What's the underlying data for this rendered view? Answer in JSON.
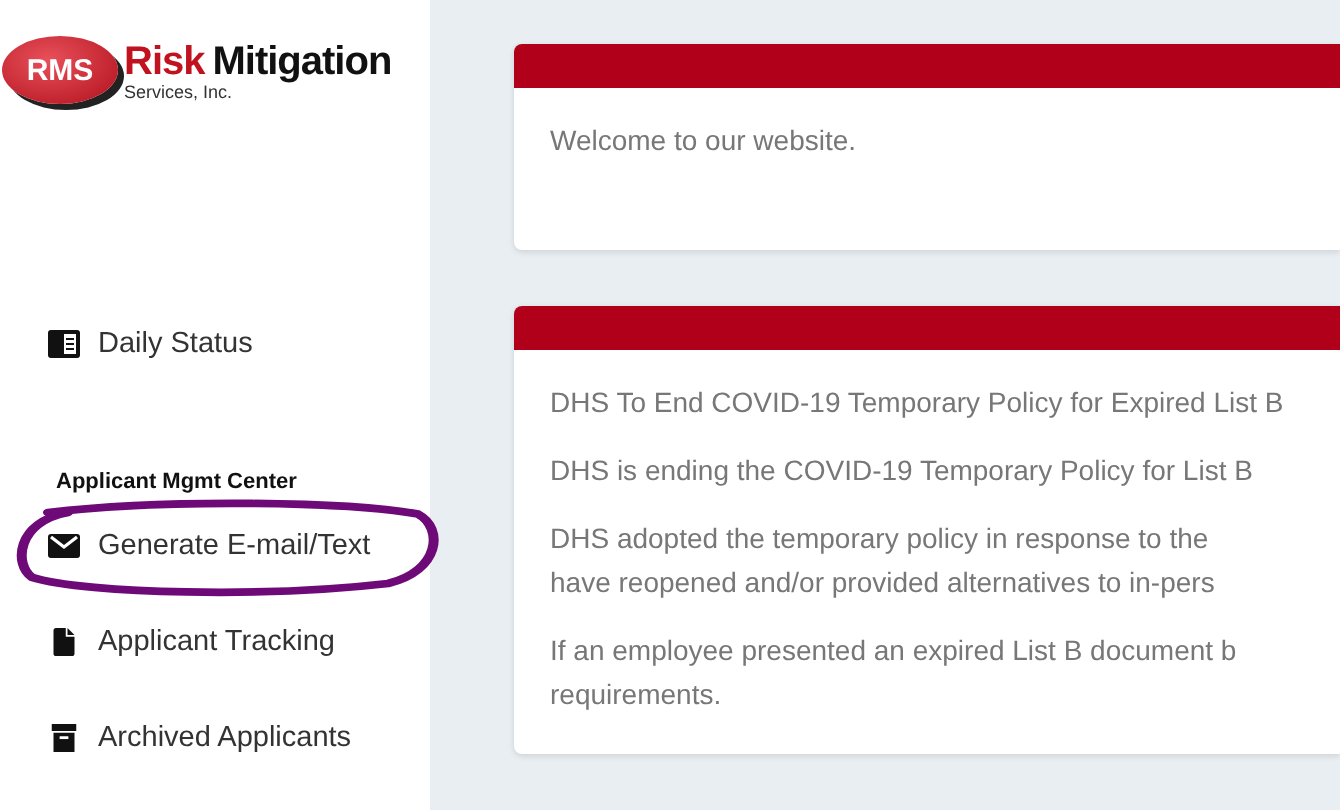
{
  "logo": {
    "badge": "RMS",
    "word_1": "Risk",
    "word_2": "Mitigation",
    "subtitle": "Services, Inc."
  },
  "sidebar": {
    "items": [
      {
        "kind": "item",
        "label": "Daily Status"
      },
      {
        "kind": "heading",
        "label": "Applicant Mgmt Center"
      },
      {
        "kind": "item",
        "label": "Generate E-mail/Text",
        "circled": true
      },
      {
        "kind": "item",
        "label": "Applicant Tracking"
      },
      {
        "kind": "item",
        "label": "Archived Applicants"
      }
    ]
  },
  "cards": [
    {
      "paragraphs": [
        [
          "Welcome to our website."
        ]
      ]
    },
    {
      "paragraphs": [
        [
          "DHS To End COVID-19 Temporary Policy for Expired List B"
        ],
        [
          "DHS is ending the COVID-19 Temporary Policy for List B"
        ],
        [
          "DHS adopted the temporary policy in response to the",
          "have reopened and/or provided alternatives to in-pers"
        ],
        [
          "If an employee presented an expired List B document b",
          "requirements."
        ]
      ]
    }
  ]
}
